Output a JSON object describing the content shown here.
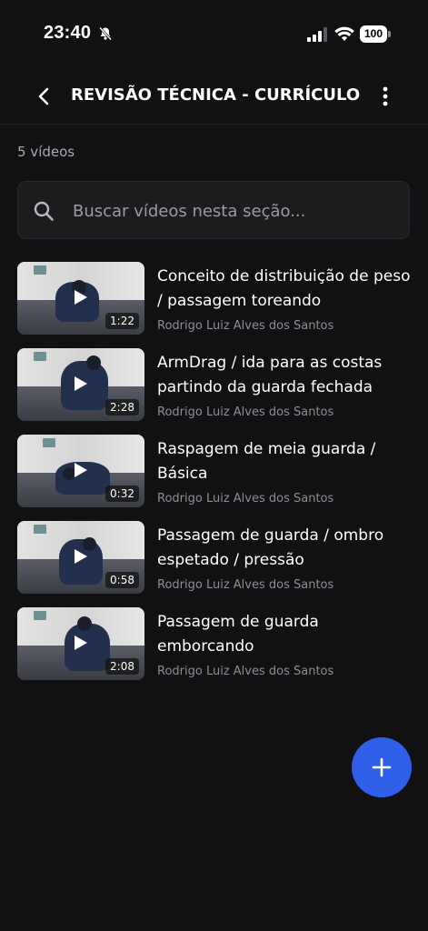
{
  "status_bar": {
    "time": "23:40",
    "battery": "100",
    "icons": [
      "bell-slash-icon",
      "signal-icon",
      "wifi-icon",
      "battery-icon"
    ]
  },
  "header": {
    "title": "REVISÃO TÉCNICA - CURRÍCULO",
    "back_icon": "chevron-left-icon",
    "more_icon": "more-vertical-icon"
  },
  "video_count": "5 vídeos",
  "search": {
    "placeholder": "Buscar vídeos nesta seção...",
    "value": "",
    "icon": "search-icon"
  },
  "videos": [
    {
      "title": "Conceito de distribuição de peso / passagem toreando",
      "author": "Rodrigo Luiz Alves dos Santos",
      "duration": "1:22"
    },
    {
      "title": "ArmDrag / ida para as costas partindo da guarda fechada",
      "author": "Rodrigo Luiz Alves dos Santos",
      "duration": "2:28"
    },
    {
      "title": "Raspagem de meia guarda / Básica",
      "author": "Rodrigo Luiz Alves dos Santos",
      "duration": "0:32"
    },
    {
      "title": "Passagem de guarda / ombro espetado / pressão",
      "author": "Rodrigo Luiz Alves dos Santos",
      "duration": "0:58"
    },
    {
      "title": "Passagem de guarda emborcando",
      "author": "Rodrigo Luiz Alves dos Santos",
      "duration": "2:08"
    }
  ],
  "fab": {
    "icon": "plus-icon"
  },
  "colors": {
    "background": "#111113",
    "accent": "#2f5ee9",
    "secondary_text": "#8e8e93",
    "search_bg": "#1c1c1f"
  }
}
